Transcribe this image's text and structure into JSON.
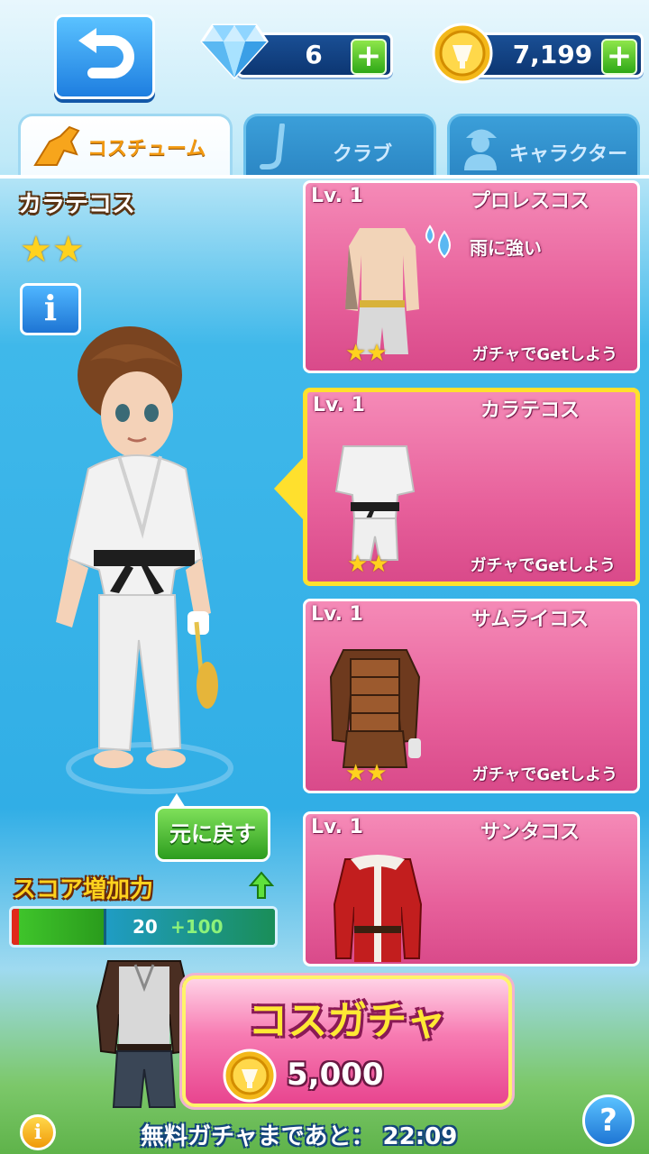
{
  "header": {
    "diamonds": "6",
    "coins": "7,199"
  },
  "tabs": [
    {
      "label": "コスチューム",
      "active": true
    },
    {
      "label": "クラブ",
      "active": false
    },
    {
      "label": "キャラクター",
      "active": false
    }
  ],
  "preview": {
    "costume_name": "カラテコス",
    "stars": 2,
    "info_label": "i",
    "reset_label": "元に戻す",
    "score_label": "スコア増加力",
    "score_value": "20",
    "score_bonus": "+100",
    "score_fill": 0.35
  },
  "costumes": [
    {
      "level": "Lv. 1",
      "name": "プロレスコス",
      "trait": "雨に強い",
      "stars": 2,
      "get_label": "ガチャでGetしよう"
    },
    {
      "level": "Lv. 1",
      "name": "カラテコス",
      "trait": "",
      "stars": 2,
      "get_label": "ガチャでGetしよう",
      "selected": true
    },
    {
      "level": "Lv. 1",
      "name": "サムライコス",
      "trait": "",
      "stars": 2,
      "get_label": "ガチャでGetしよう"
    },
    {
      "level": "Lv. 1",
      "name": "サンタコス",
      "trait": "",
      "stars": 0,
      "get_label": ""
    }
  ],
  "gacha": {
    "title": "コスガチャ",
    "price": "5,000",
    "timer_text": "無料ガチャまであと： 22:09"
  },
  "colors": {
    "card_pink": "#e7609b",
    "selected_border": "#ffe02d",
    "accent_blue": "#1e7ee0",
    "plus_green": "#2ea817"
  }
}
